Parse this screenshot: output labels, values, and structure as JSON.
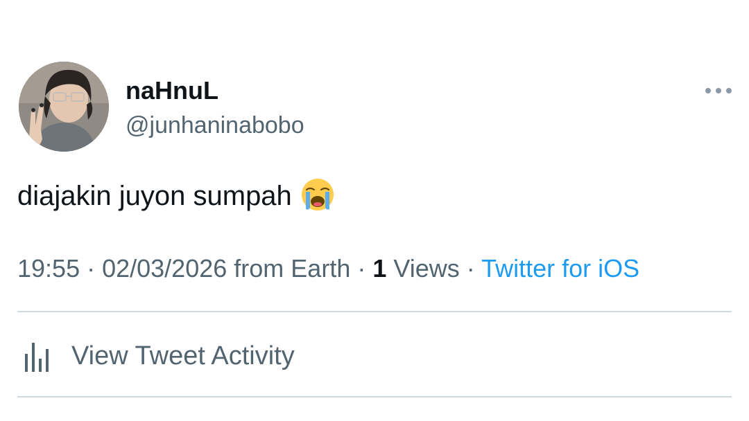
{
  "tweet": {
    "author": {
      "display_name": "naHnuL",
      "handle": "@junhaninabobo",
      "avatar": "profile-photo"
    },
    "text": "diajakin juyon sumpah",
    "emoji": "loudly-crying-face",
    "meta": {
      "time": "19:55",
      "separator": " · ",
      "date": "02/03/2026",
      "location": "from Earth",
      "views_count": "1",
      "views_label": "Views",
      "source": "Twitter for iOS"
    },
    "activity_label": "View Tweet Activity",
    "icons": {
      "more": "more-horizontal-icon",
      "activity": "bar-chart-icon"
    },
    "colors": {
      "link": "#1d9bf0",
      "secondary_text": "#536471",
      "primary_text": "#0f1419",
      "divider": "#cfd9de"
    }
  }
}
